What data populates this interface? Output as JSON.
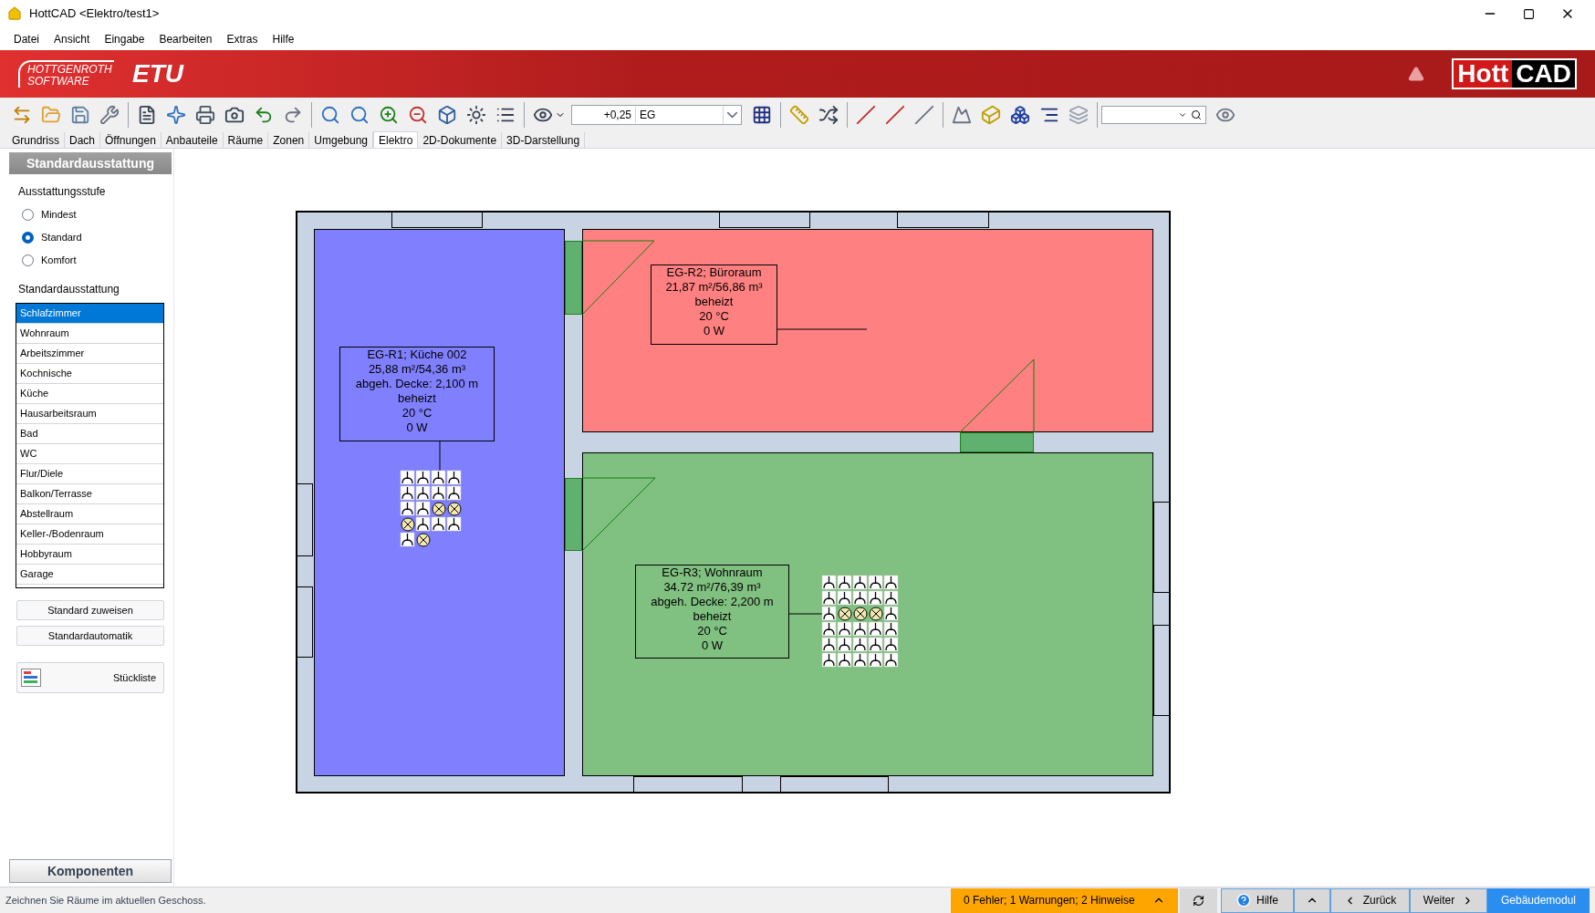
{
  "window": {
    "title": "HottCAD <Elektro/test1>"
  },
  "menu": [
    "Datei",
    "Ansicht",
    "Eingabe",
    "Bearbeiten",
    "Extras",
    "Hilfe"
  ],
  "banner": {
    "company_line_1": "HOTTGENROTH",
    "company_line_2": "SOFTWARE",
    "product": "ETU",
    "brand_part_1": "Hott",
    "brand_part_2": "CAD"
  },
  "toolbar": {
    "elevation": "+0,25",
    "floor": "EG"
  },
  "tabs": [
    {
      "label": "Grundriss",
      "selected": false
    },
    {
      "label": "Dach",
      "selected": false
    },
    {
      "label": "Öffnungen",
      "selected": false
    },
    {
      "label": "Anbauteile",
      "selected": false
    },
    {
      "label": "Räume",
      "selected": false
    },
    {
      "label": "Zonen",
      "selected": false
    },
    {
      "label": "Umgebung",
      "selected": false
    },
    {
      "label": "Elektro",
      "selected": true
    },
    {
      "label": "2D-Dokumente",
      "selected": false
    },
    {
      "label": "3D-Darstellung",
      "selected": false
    }
  ],
  "left_panel": {
    "title": "Standardausstattung",
    "level_label": "Ausstattungsstufe",
    "levels": [
      {
        "label": "Mindest",
        "selected": false
      },
      {
        "label": "Standard",
        "selected": true
      },
      {
        "label": "Komfort",
        "selected": false
      }
    ],
    "list_label": "Standardausstattung",
    "room_types": [
      {
        "label": "Schlafzimmer",
        "selected": true
      },
      {
        "label": "Wohnraum",
        "selected": false
      },
      {
        "label": "Arbeitszimmer",
        "selected": false
      },
      {
        "label": "Kochnische",
        "selected": false
      },
      {
        "label": "Küche",
        "selected": false
      },
      {
        "label": "Hausarbeitsraum",
        "selected": false
      },
      {
        "label": "Bad",
        "selected": false
      },
      {
        "label": "WC",
        "selected": false
      },
      {
        "label": "Flur/Diele",
        "selected": false
      },
      {
        "label": "Balkon/Terrasse",
        "selected": false
      },
      {
        "label": "Abstellraum",
        "selected": false
      },
      {
        "label": "Keller-/Bodenraum",
        "selected": false
      },
      {
        "label": "Hobbyraum",
        "selected": false
      },
      {
        "label": "Garage",
        "selected": false
      }
    ],
    "buttons": [
      "Standard zuweisen",
      "Standardautomatik"
    ],
    "parts_list_button": "Stückliste",
    "footer_button": "Komponenten"
  },
  "plan": {
    "rooms": [
      {
        "color": "#8080ff",
        "label": [
          "EG-R1; Küche 002",
          "25,88 m²/54,36 m³",
          "abgeh. Decke: 2,100 m",
          "beheizt",
          "20 °C",
          "0 W"
        ]
      },
      {
        "color": "#ff8080",
        "label": [
          "EG-R2; Büroraum",
          "21,87 m²/56,86 m³",
          "beheizt",
          "20 °C",
          "0 W"
        ]
      },
      {
        "color": "#80c080",
        "label": [
          "EG-R3; Wohnraum",
          "34.72 m²/76,39 m³",
          "abgeh. Decke: 2,200 m",
          "beheizt",
          "20 °C",
          "0 W"
        ]
      }
    ]
  },
  "status_bar": {
    "hint": "Zeichnen Sie Räume im aktuellen Geschoss.",
    "messages": "0 Fehler; 1 Warnungen; 2 Hinweise",
    "help": "Hilfe",
    "back": "Zurück",
    "next": "Weiter",
    "module": "Gebäudemodul"
  }
}
